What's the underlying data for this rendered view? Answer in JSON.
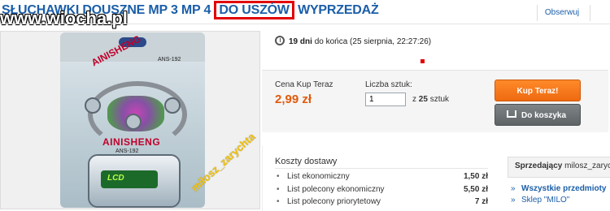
{
  "watermark": "www.wiocha.pl",
  "listing": {
    "title_prefix": "SŁUCHAWKI DOUSZNE MP 3 MP 4",
    "title_highlight": "DO USZÓW",
    "title_suffix": "WYPRZEDAŻ",
    "watch_label": "Obserwuj"
  },
  "product_image": {
    "brand_top": "AINISHENG",
    "brand_mid": "AINISHENG",
    "model_code_top": "ANS-192",
    "model_code_mid": "ANS-192",
    "clip_text": "LCD",
    "overlay_text": "miłosz_zarychta"
  },
  "timer": {
    "days": "19 dni",
    "text": "do końca (25 sierpnia, 22:27:26)"
  },
  "purchase": {
    "price_label": "Cena Kup Teraz",
    "price_value": "2,99 zł",
    "quantity_label": "Liczba sztuk:",
    "quantity_value": "1",
    "quantity_of_prefix": "z",
    "quantity_available": "25",
    "quantity_unit": "sztuk",
    "buy_now_label": "Kup Teraz!",
    "add_to_cart_label": "Do koszyka"
  },
  "shipping": {
    "title": "Koszty dostawy",
    "rows": [
      {
        "bullet": "•",
        "name": "List ekonomiczny",
        "price": "1,50 zł"
      },
      {
        "bullet": "•",
        "name": "List polecony ekonomiczny",
        "price": "5,50 zł"
      },
      {
        "bullet": "•",
        "name": "List polecony priorytetowy",
        "price": "7 zł"
      }
    ]
  },
  "seller": {
    "label": "Sprzedający",
    "name": "milosz_zarych",
    "links": [
      {
        "bullet": "»",
        "text": "Wszystkie przedmioty"
      },
      {
        "bullet": "»",
        "text": "Sklep \"MILO\""
      }
    ]
  },
  "colors": {
    "accent_link": "#1b5ea8",
    "price": "#e05a0c",
    "buy_button": "#ee6a10",
    "highlight_box": "#e20000"
  }
}
